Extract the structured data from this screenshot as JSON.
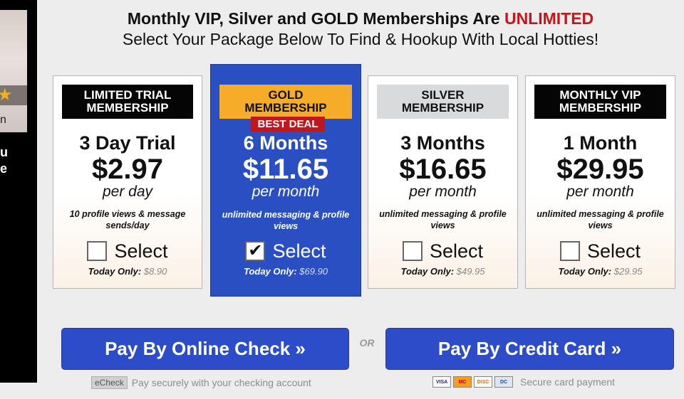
{
  "side_panel": {
    "photo_text": "n",
    "side_lines": [
      "u",
      "e"
    ]
  },
  "headline": {
    "prefix": "Monthly VIP, Silver and GOLD Memberships Are ",
    "accent": "UNLIMITED"
  },
  "subheadline": "Select Your Package Below To Find & Hookup With Local Hotties!",
  "plans": [
    {
      "header": "LIMITED TRIAL MEMBERSHIP",
      "duration": "3 Day Trial",
      "price": "$2.97",
      "unit": "per day",
      "desc": "10 profile views & message sends/day",
      "select_label": "Select",
      "selected": false,
      "today_label": "Today Only:",
      "today_price": "$8.90"
    },
    {
      "header": "GOLD MEMBERSHIP",
      "badge": "BEST DEAL",
      "duration": "6 Months",
      "price": "$11.65",
      "unit": "per month",
      "desc": "unlimited messaging & profile views",
      "select_label": "Select",
      "selected": true,
      "today_label": "Today Only:",
      "today_price": "$69.90"
    },
    {
      "header": "SILVER MEMBERSHIP",
      "duration": "3 Months",
      "price": "$16.65",
      "unit": "per month",
      "desc": "unlimited messaging & profile views",
      "select_label": "Select",
      "selected": false,
      "today_label": "Today Only:",
      "today_price": "$49.95"
    },
    {
      "header": "MONTHLY VIP MEMBERSHIP",
      "duration": "1 Month",
      "price": "$29.95",
      "unit": "per month",
      "desc": "unlimited messaging & profile views",
      "select_label": "Select",
      "selected": false,
      "today_label": "Today Only:",
      "today_price": "$29.95"
    }
  ],
  "checkmark": "✔",
  "payment": {
    "check_button": "Pay By Online Check »",
    "or_text": "OR",
    "card_button": "Pay By Credit Card »",
    "echeck_badge": "eCheck",
    "check_note": "Pay securely with your checking account",
    "card_logos": [
      "VISA",
      "MC",
      "DISC",
      "DC"
    ],
    "card_note": "Secure card payment"
  },
  "colors": {
    "brand_blue": "#2c4cc9",
    "accent_red": "#c4161c",
    "gold": "#f6ab29",
    "silver": "#d9dadc"
  }
}
